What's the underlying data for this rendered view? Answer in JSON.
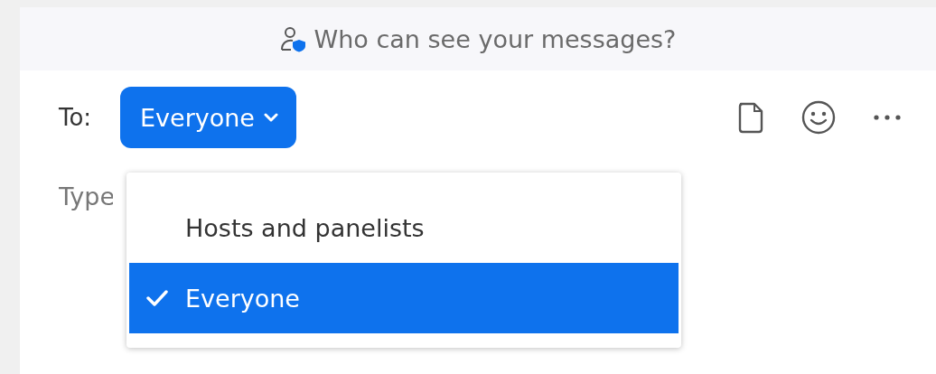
{
  "header": {
    "text": "Who can see your messages?"
  },
  "compose": {
    "to_label": "To:",
    "recipient_button": "Everyone",
    "placeholder": "Type"
  },
  "recipient_menu": {
    "items": [
      {
        "label": "Hosts and panelists",
        "selected": false
      },
      {
        "label": "Everyone",
        "selected": true
      }
    ]
  }
}
